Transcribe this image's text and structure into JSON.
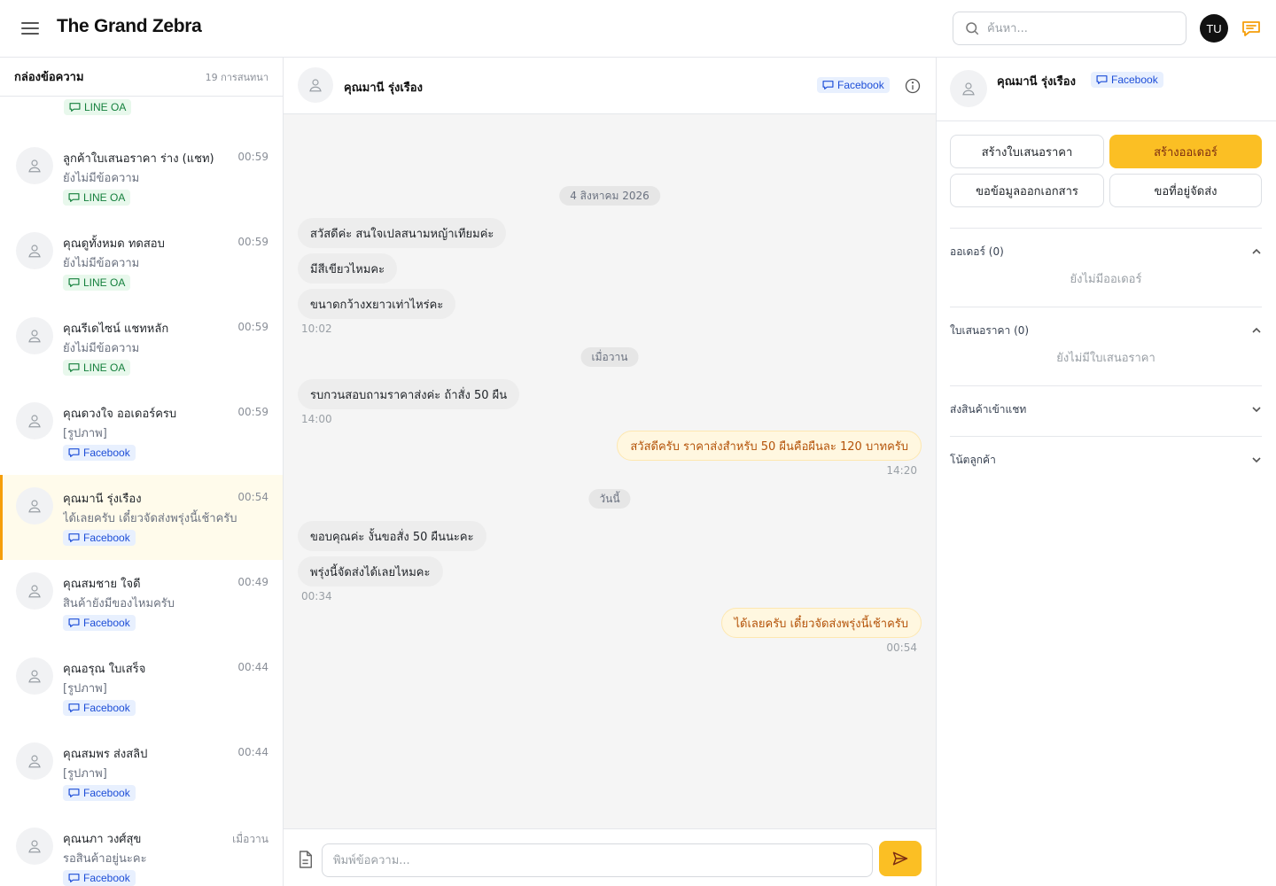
{
  "app": {
    "title": "The Grand Zebra",
    "search_placeholder": "ค้นหา...",
    "user_initials": "TU"
  },
  "colors": {
    "accent": "#fbbf24",
    "accent_border": "#f59e0b",
    "line_green": "#15803d",
    "facebook_blue": "#1d4ed8"
  },
  "inbox": {
    "title": "กล่องข้อความ",
    "count": "19 การสนทนา",
    "partial_channel": "LINE OA",
    "conversations": [
      {
        "name": "ลูกค้าใบเสนอราคา ร่าง (แชท)",
        "time": "00:59",
        "preview": "ยังไม่มีข้อความ",
        "channel": "LINE OA",
        "channel_type": "line",
        "icon": "chat-bubble-icon"
      },
      {
        "name": "คุณดูทั้งหมด ทดสอบ",
        "time": "00:59",
        "preview": "ยังไม่มีข้อความ",
        "channel": "LINE OA",
        "channel_type": "line",
        "icon": "chat-bubble-icon"
      },
      {
        "name": "คุณรีเดไซน์ แชทหลัก",
        "time": "00:59",
        "preview": "ยังไม่มีข้อความ",
        "channel": "LINE OA",
        "channel_type": "line",
        "icon": "chat-bubble-icon"
      },
      {
        "name": "คุณดวงใจ ออเดอร์ครบ",
        "time": "00:59",
        "preview": "[รูปภาพ]",
        "channel": "Facebook",
        "channel_type": "facebook",
        "icon": "chat-bubble-icon"
      },
      {
        "name": "คุณมานี รุ่งเรือง",
        "time": "00:54",
        "preview": "ได้เลยครับ เดี๋ยวจัดส่งพรุ่งนี้เช้าครับ",
        "channel": "Facebook",
        "channel_type": "facebook",
        "active": true,
        "icon": "chat-bubble-icon"
      },
      {
        "name": "คุณสมชาย ใจดี",
        "time": "00:49",
        "preview": "สินค้ายังมีของไหมครับ",
        "channel": "Facebook",
        "channel_type": "facebook",
        "icon": "chat-bubble-icon"
      },
      {
        "name": "คุณอรุณ ใบเสร็จ",
        "time": "00:44",
        "preview": "[รูปภาพ]",
        "channel": "Facebook",
        "channel_type": "facebook",
        "icon": "chat-bubble-icon"
      },
      {
        "name": "คุณสมพร ส่งสลิป",
        "time": "00:44",
        "preview": "[รูปภาพ]",
        "channel": "Facebook",
        "channel_type": "facebook",
        "icon": "chat-bubble-icon"
      },
      {
        "name": "คุณนภา วงศ์สุข",
        "time": "เมื่อวาน",
        "preview": "รอสินค้าอยู่นะคะ",
        "channel": "Facebook",
        "channel_type": "facebook",
        "icon": "chat-bubble-icon"
      }
    ]
  },
  "chat": {
    "contact_name": "คุณมานี รุ่งเรือง",
    "channel": "Facebook",
    "composer_placeholder": "พิมพ์ข้อความ...",
    "date_1": "4 สิงหาคม 2026",
    "msg_1": "สวัสดีค่ะ สนใจเปลสนามหญ้าเทียมค่ะ",
    "msg_2": "มีสีเขียวไหมคะ",
    "msg_3": "ขนาดกว้างxยาวเท่าไหร่คะ",
    "time_1": "10:02",
    "date_2": "เมื่อวาน",
    "msg_4": "รบกวนสอบถามราคาส่งค่ะ ถ้าสั่ง 50 ผืน",
    "time_2": "14:00",
    "msg_5": "สวัสดีครับ ราคาส่งสำหรับ 50 ผืนคือผืนละ 120 บาทครับ",
    "time_3": "14:20",
    "date_3": "วันนี้",
    "msg_6": "ขอบคุณค่ะ งั้นขอสั่ง 50 ผืนนะคะ",
    "msg_7": "พรุ่งนี้จัดส่งได้เลยไหมคะ",
    "time_4": "00:34",
    "msg_8": "ได้เลยครับ เดี๋ยวจัดส่งพรุ่งนี้เช้าครับ",
    "time_5": "00:54"
  },
  "details": {
    "contact_name": "คุณมานี รุ่งเรือง",
    "channel": "Facebook",
    "btn_quote": "สร้างใบเสนอราคา",
    "btn_order": "สร้างออเดอร์",
    "btn_tax": "ขอข้อมูลออกเอกสาร",
    "btn_address": "ขอที่อยู่จัดส่ง",
    "orders_title": "ออเดอร์ (0)",
    "orders_empty": "ยังไม่มีออเดอร์",
    "quotes_title": "ใบเสนอราคา (0)",
    "quotes_empty": "ยังไม่มีใบเสนอราคา",
    "send_product_title": "ส่งสินค้าเข้าแชท",
    "notes_title": "โน้ตลูกค้า"
  }
}
